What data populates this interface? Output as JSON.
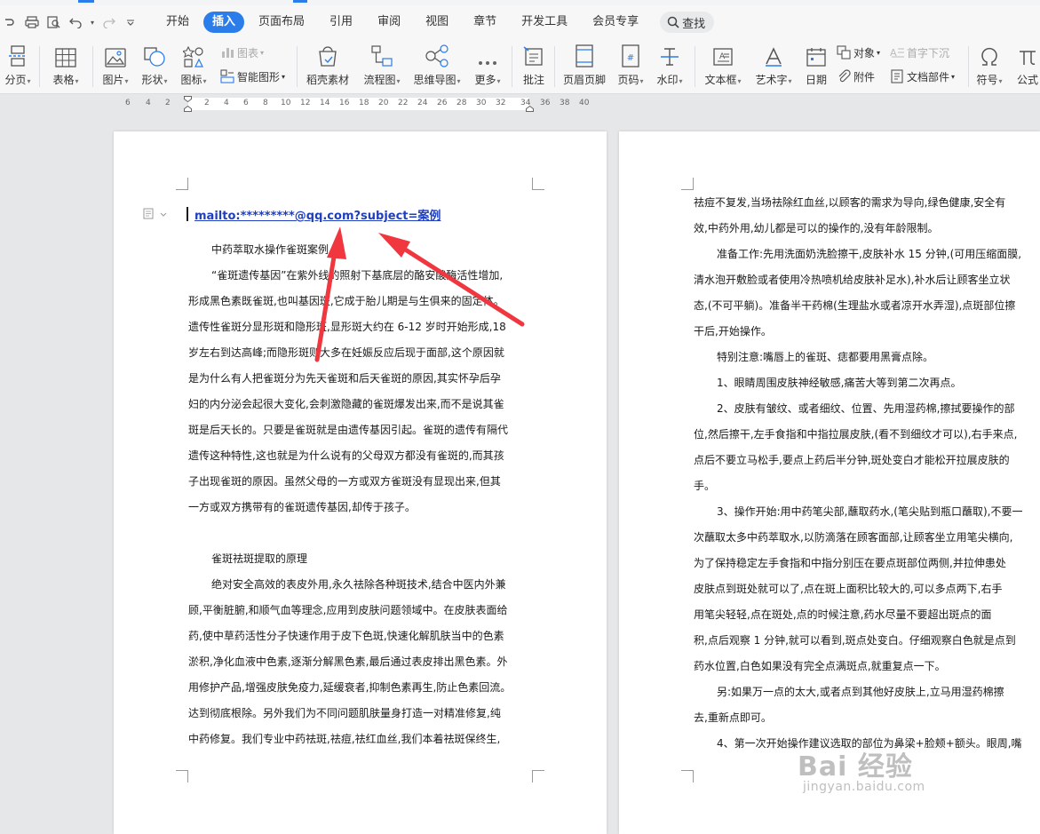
{
  "menu": {
    "items": [
      "开始",
      "插入",
      "页面布局",
      "引用",
      "审阅",
      "视图",
      "章节",
      "开发工具",
      "会员专享"
    ],
    "active_index": 1,
    "search_label": "查找"
  },
  "ribbon": {
    "page_break": "分页",
    "table": "表格",
    "picture": "图片",
    "shape": "形状",
    "icon": "图标",
    "chart": "图表",
    "smart_shape": "智能图形",
    "docer_material": "稻壳素材",
    "flowchart": "流程图",
    "mindmap": "思维导图",
    "more": "更多",
    "comment": "批注",
    "header_footer": "页眉页脚",
    "page_number": "页码",
    "watermark": "水印",
    "textbox": "文本框",
    "wordart": "艺术字",
    "date": "日期",
    "object": "对象",
    "attachment": "附件",
    "dropcap": "首字下沉",
    "doc_parts": "文档部件",
    "symbol": "符号",
    "formula": "公式"
  },
  "ruler": {
    "ticks": [
      "6",
      "4",
      "2",
      "2",
      "4",
      "6",
      "8",
      "10",
      "12",
      "14",
      "16",
      "18",
      "20",
      "22",
      "24",
      "26",
      "28",
      "30",
      "32",
      "34",
      "36",
      "38",
      "40"
    ]
  },
  "page1": {
    "link_text": "mailto:*********@qq.com?subject=案例",
    "lines": [
      {
        "text": "中药萃取水操作雀斑案例",
        "indent": true
      },
      {
        "text": "“雀斑遗传基因”在紫外线的照射下基底层的酪安酸酶活性增加,",
        "indent": true
      },
      {
        "text": "形成黑色素既雀斑,也叫基因斑,它成于胎儿期是与生俱来的固定体。",
        "indent": false
      },
      {
        "text": "遗传性雀斑分显形斑和隐形斑,显形斑大约在 6-12 岁时开始形成,18",
        "indent": false
      },
      {
        "text": "岁左右到达高峰;而隐形斑则大多在妊娠反应后现于面部,这个原因就",
        "indent": false
      },
      {
        "text": "是为什么有人把雀斑分为先天雀斑和后天雀斑的原因,其实怀孕后孕",
        "indent": false
      },
      {
        "text": "妇的内分泌会起很大变化,会刺激隐藏的雀斑爆发出来,而不是说其雀",
        "indent": false
      },
      {
        "text": "斑是后天长的。只要是雀斑就是由遗传基因引起。雀斑的遗传有隔代",
        "indent": false
      },
      {
        "text": "遗传这种特性,这也就是为什么说有的父母双方都没有雀斑的,而其孩",
        "indent": false
      },
      {
        "text": "子出现雀斑的原因。虽然父母的一方或双方雀斑没有显现出来,但其",
        "indent": false
      },
      {
        "text": "一方或双方携带有的雀斑遗传基因,却传于孩子。",
        "indent": false
      },
      {
        "text": "",
        "indent": false
      },
      {
        "text": "雀斑祛斑提取的原理",
        "indent": true
      },
      {
        "text": "绝对安全高效的表皮外用,永久祛除各种斑技术,结合中医内外兼",
        "indent": true
      },
      {
        "text": "顾,平衡脏腑,和顺气血等理念,应用到皮肤问题领域中。在皮肤表面给",
        "indent": false
      },
      {
        "text": "药,使中草药活性分子快速作用于皮下色斑,快速化解肌肤当中的色素",
        "indent": false
      },
      {
        "text": "淤积,净化血液中色素,逐渐分解黑色素,最后通过表皮排出黑色素。外",
        "indent": false
      },
      {
        "text": "用修护产品,增强皮肤免疫力,延缓衰者,抑制色素再生,防止色素回流。",
        "indent": false
      },
      {
        "text": "达到彻底根除。另外我们为不同问题肌肤量身打造一对精准修复,纯",
        "indent": false
      },
      {
        "text": "中药修复。我们专业中药祛斑,祛痘,祛红血丝,我们本着祛斑保终生,",
        "indent": false
      }
    ]
  },
  "page2": {
    "lines": [
      {
        "text": "祛痘不复发,当场祛除红血丝,以顾客的需求为导向,绿色健康,安全有",
        "indent": false
      },
      {
        "text": "效,中药外用,幼儿都是可以的操作的,没有年龄限制。",
        "indent": false
      },
      {
        "text": "准备工作:先用洗面奶洗脸擦干,皮肤补水 15 分钟,(可用压缩面膜,",
        "indent": true
      },
      {
        "text": "清水泡开敷脸或者使用冷热喷机给皮肤补足水),补水后让顾客坐立状",
        "indent": false
      },
      {
        "text": "态,(不可平躺)。准备半干药棉(生理盐水或者凉开水弄湿),点斑部位擦",
        "indent": false
      },
      {
        "text": "干后,开始操作。",
        "indent": false
      },
      {
        "text": "特别注意:嘴唇上的雀斑、痣都要用黑膏点除。",
        "indent": true
      },
      {
        "text": "1、眼睛周围皮肤神经敏感,痛苦大等到第二次再点。",
        "indent": true
      },
      {
        "text": "2、皮肤有皱纹、或者细纹、位置、先用湿药棉,擦拭要操作的部",
        "indent": true
      },
      {
        "text": "位,然后擦干,左手食指和中指拉展皮肤,(看不到细纹才可以),右手来点,",
        "indent": false
      },
      {
        "text": "点后不要立马松手,要点上药后半分钟,斑处变白才能松开拉展皮肤的",
        "indent": false
      },
      {
        "text": "手。",
        "indent": false
      },
      {
        "text": "3、操作开始:用中药笔尖部,蘸取药水,(笔尖贴到瓶口蘸取),不要一",
        "indent": true
      },
      {
        "text": "次蘸取太多中药萃取水,以防滴落在顾客面部,让顾客坐立用笔尖横向,",
        "indent": false
      },
      {
        "text": "为了保持稳定左手食指和中指分别压在要点斑部位两侧,并拉伸患处",
        "indent": false
      },
      {
        "text": "皮肤点到斑处就可以了,点在斑上面积比较大的,可以多点两下,右手",
        "indent": false
      },
      {
        "text": "用笔尖轻轻,点在斑处,点的时候注意,药水尽量不要超出斑点的面",
        "indent": false
      },
      {
        "text": "积,点后观察 1 分钟,就可以看到,斑点处变白。仔细观察白色就是点到",
        "indent": false
      },
      {
        "text": "药水位置,白色如果没有完全点满斑点,就重复点一下。",
        "indent": false
      },
      {
        "text": "另:如果万一点的太大,或者点到其他好皮肤上,立马用湿药棉擦",
        "indent": true
      },
      {
        "text": "去,重新点即可。",
        "indent": false
      },
      {
        "text": "4、第一次开始操作建议选取的部位为鼻梁+脸颊+额头。眼周,嘴",
        "indent": true
      }
    ]
  },
  "watermark": {
    "main": "Bai 经验",
    "sub": "jingyan.baidu.com"
  },
  "colors": {
    "accent": "#2b7de9",
    "link": "#1f3fbf",
    "arrow": "#f0363e"
  }
}
